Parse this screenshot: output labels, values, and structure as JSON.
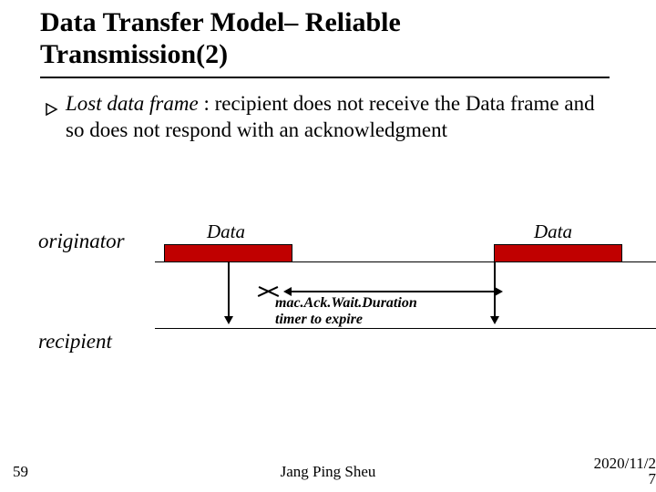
{
  "title_line1": "Data Transfer Model– Reliable",
  "title_line2": "Transmission(2)",
  "bullet": {
    "lead": "Lost data frame",
    "rest": " : recipient does not receive the Data frame and so does not respond with an acknowledgment"
  },
  "diagram": {
    "originator_label": "originator",
    "recipient_label": "recipient",
    "data_label_1": "Data",
    "data_label_2": "Data",
    "timer_line1": "mac.Ack.Wait.Duration",
    "timer_line2": "timer to expire"
  },
  "footer": {
    "slide_number": "59",
    "author": "Jang Ping Sheu",
    "date": "2020/11/2",
    "date_tail": "7"
  }
}
